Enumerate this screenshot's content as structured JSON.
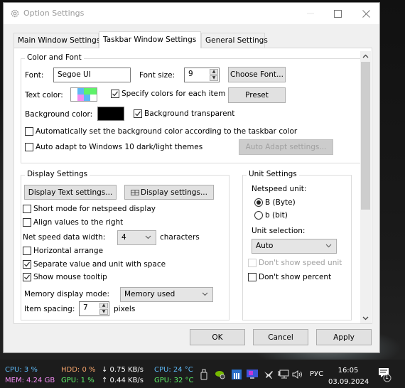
{
  "window": {
    "title": "Option Settings",
    "controls": {
      "minimize": "minimize",
      "maximize": "maximize",
      "close": "close"
    }
  },
  "tabs": [
    {
      "label": "Main Window Settings",
      "active": false
    },
    {
      "label": "Taskbar Window Settings",
      "active": true
    },
    {
      "label": "General Settings",
      "active": false
    }
  ],
  "color_font": {
    "legend": "Color and Font",
    "font_label": "Font:",
    "font_value": "Segoe UI",
    "font_size_label": "Font size:",
    "font_size_value": "9",
    "choose_font_button": "Choose Font...",
    "text_color_label": "Text color:",
    "text_color_swatch": [
      "#ffffff",
      "#5db8f5",
      "#5ef26a",
      "#5ef26a",
      "#ffffff",
      "#f28cf2",
      "#5db8f5",
      "#ffffff"
    ],
    "specify_colors_label": "Specify colors for each item",
    "specify_colors_checked": true,
    "preset_button": "Preset",
    "background_color_label": "Background color:",
    "background_color": "#000000",
    "background_transparent_label": "Background transparent",
    "background_transparent_checked": true,
    "auto_bg_label": "Automatically set the background color according to the taskbar color",
    "auto_bg_checked": false,
    "auto_adapt_label": "Auto adapt to Windows 10 dark/light themes",
    "auto_adapt_checked": false,
    "auto_adapt_settings_button": "Auto Adapt settings..."
  },
  "display_settings": {
    "legend": "Display Settings",
    "display_text_button": "Display Text settings...",
    "display_settings_button": "Display settings...",
    "short_mode_label": "Short mode for netspeed display",
    "short_mode_checked": false,
    "align_right_label": "Align values to the right",
    "align_right_checked": false,
    "net_width_label": "Net speed data width:",
    "net_width_value": "4",
    "net_width_unit": "characters",
    "horizontal_label": "Horizontal arrange",
    "horizontal_checked": false,
    "separate_label": "Separate value and unit with space",
    "separate_checked": true,
    "tooltip_label": "Show mouse tooltip",
    "tooltip_checked": true,
    "memory_mode_label": "Memory display mode:",
    "memory_mode_value": "Memory used",
    "item_spacing_label": "Item spacing:",
    "item_spacing_value": "7",
    "item_spacing_unit": "pixels"
  },
  "unit_settings": {
    "legend": "Unit Settings",
    "netspeed_unit_label": "Netspeed unit:",
    "byte_label": "B (Byte)",
    "byte_selected": true,
    "bit_label": "b (bit)",
    "bit_selected": false,
    "unit_selection_label": "Unit selection:",
    "unit_selection_value": "Auto",
    "dont_show_unit_label": "Don't show speed unit",
    "dont_show_unit_checked": false,
    "dont_show_unit_disabled": true,
    "dont_show_percent_label": "Don't show percent",
    "dont_show_percent_checked": false
  },
  "footer": {
    "ok": "OK",
    "cancel": "Cancel",
    "apply": "Apply"
  },
  "taskbar": {
    "cpu": "CPU:  3 %",
    "mem": "MEM: 4.24 GB",
    "hdd": "HDD: 0 %",
    "gpu": "GPU:  1 %",
    "down": "↓ 0.75 KB/s",
    "up": "↑ 0.44 KB/s",
    "cpu_temp": "CPU: 24 °C",
    "gpu_temp": "GPU: 32 °C",
    "colors": {
      "cpu": "#5db8f5",
      "mem": "#f28cf2",
      "hdd": "#f5a46b",
      "gpu": "#5ef26a",
      "speed": "#ffffff"
    },
    "language": "РУС",
    "time": "16:05",
    "date": "03.09.2024",
    "notification_count": "1"
  }
}
